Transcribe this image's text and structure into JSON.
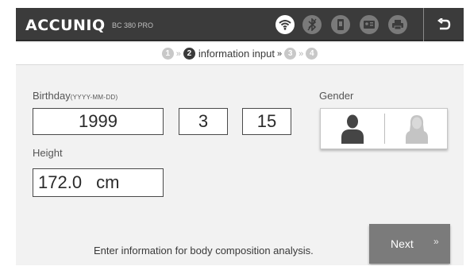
{
  "header": {
    "brand": "ACCUNIQ",
    "model": "BC 380 PRO",
    "icons": [
      "wifi-icon",
      "bluetooth-icon",
      "usb-drive-icon",
      "id-card-icon",
      "printer-icon"
    ],
    "back_icon": "back-arrow-icon"
  },
  "steps": {
    "step1": "1",
    "step2": "2",
    "step2_label": "information input",
    "step3": "3",
    "step4": "4",
    "separator": "»"
  },
  "form": {
    "birthday_label": "Birthday",
    "birthday_format": "(YYYY-MM-DD)",
    "year": "1999",
    "month": "3",
    "day": "15",
    "gender_label": "Gender",
    "height_label": "Height",
    "height_value": "172.0",
    "height_unit": "cm"
  },
  "footer": {
    "hint": "Enter information for body composition analysis.",
    "next_label": "Next",
    "next_chevron": "»"
  },
  "colors": {
    "header_bg": "#3b3b3b",
    "button_bg": "#7b7b7b",
    "active_step": "#3a3a3a"
  }
}
